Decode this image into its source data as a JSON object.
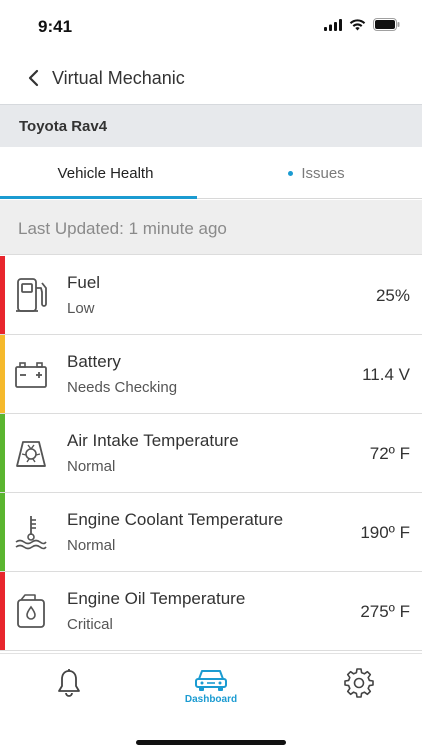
{
  "status_bar": {
    "time": "9:41"
  },
  "nav": {
    "title": "Virtual Mechanic"
  },
  "vehicle": {
    "name": "Toyota Rav4"
  },
  "tabs": [
    {
      "label": "Vehicle Health",
      "active": true
    },
    {
      "label": "Issues",
      "active": false
    }
  ],
  "updated": {
    "text": "Last Updated: 1 minute ago"
  },
  "rows": [
    {
      "title": "Fuel",
      "status": "Low",
      "value": "25%",
      "accent": "#e8262d",
      "icon": "fuel-pump-icon"
    },
    {
      "title": "Battery",
      "status": "Needs Checking",
      "value": "11.4 V",
      "accent": "#f5b92c",
      "icon": "battery-icon"
    },
    {
      "title": "Air Intake Temperature",
      "status": "Normal",
      "value": "72º F",
      "accent": "#5ab52f",
      "icon": "air-intake-icon"
    },
    {
      "title": "Engine Coolant Temperature",
      "status": "Normal",
      "value": "190º F",
      "accent": "#5ab52f",
      "icon": "coolant-temperature-icon"
    },
    {
      "title": "Engine Oil Temperature",
      "status": "Critical",
      "value": "275º F",
      "accent": "#e8262d",
      "icon": "oil-can-icon"
    }
  ],
  "tabbar": {
    "items": [
      {
        "name": "notifications",
        "icon": "bell-icon",
        "label": ""
      },
      {
        "name": "dashboard",
        "icon": "car-icon",
        "label": "Dashboard"
      },
      {
        "name": "settings",
        "icon": "gear-icon",
        "label": ""
      }
    ],
    "accent": "#1b9bd1"
  }
}
